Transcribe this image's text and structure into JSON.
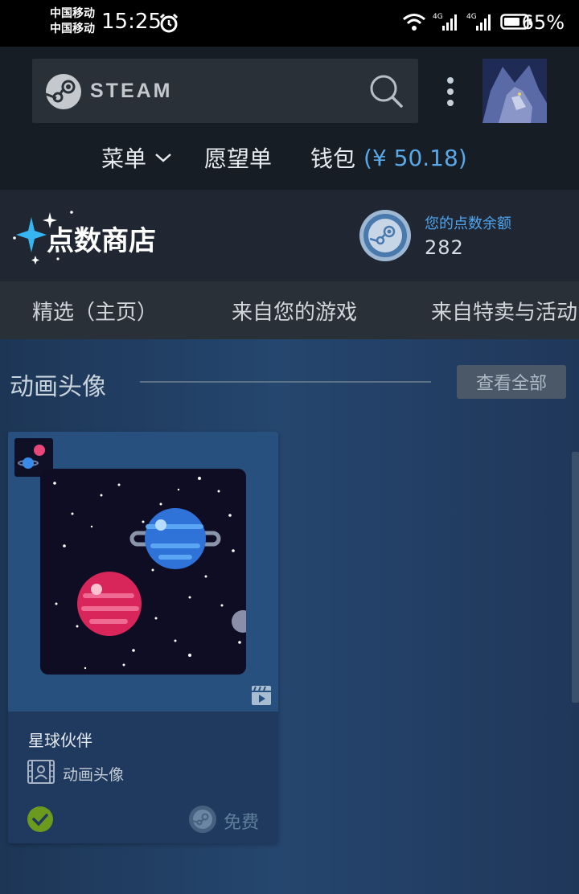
{
  "status_bar": {
    "carrier1": "中国移动",
    "carrier2": "中国移动",
    "time": "15:25",
    "battery": "65%",
    "net1": "4G",
    "net2": "4G",
    "icons": [
      "alarm-icon",
      "wifi-icon",
      "signal-icon",
      "battery-icon"
    ]
  },
  "header": {
    "logo_text": "STEAM",
    "nav": {
      "menu": "菜单",
      "wishlist": "愿望单",
      "wallet": "钱包",
      "wallet_amount": "(¥ 50.18)"
    }
  },
  "points_shop": {
    "title": "点数商店",
    "balance_label": "您的点数余额",
    "balance": "282"
  },
  "tabs": [
    "精选（主页）",
    "来自您的游戏",
    "来自特卖与活动"
  ],
  "section": {
    "title": "动画头像",
    "view_all": "查看全部"
  },
  "item": {
    "name": "星球伙伴",
    "type": "动画头像",
    "price": "免费",
    "owned": true
  },
  "colors": {
    "accent_blue": "#59a9e8",
    "header_bg": "#171d25",
    "content_bg": "#25466e",
    "owned_green": "#6c9a1f"
  }
}
